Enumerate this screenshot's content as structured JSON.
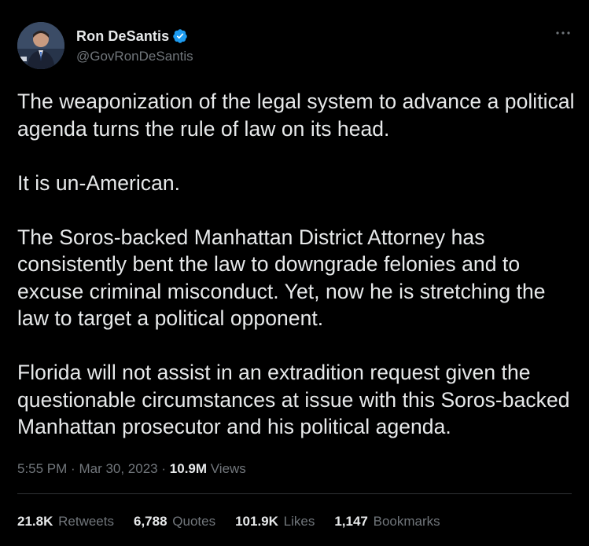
{
  "author": {
    "display_name": "Ron DeSantis",
    "handle": "@GovRonDeSantis",
    "verified_icon": "verified-badge-icon",
    "verified_color": "#1d9bf0"
  },
  "tweet": {
    "paragraphs": [
      "The weaponization of the legal system to advance a political agenda turns the rule of law on its head.",
      "It is un-American.",
      "The Soros-backed Manhattan District Attorney has consistently bent the law to downgrade felonies and to excuse criminal misconduct. Yet, now he is stretching the law to target a political opponent.",
      "Florida will not assist in an extradition request given the questionable circumstances at issue with this Soros-backed Manhattan prosecutor and his political agenda."
    ]
  },
  "meta": {
    "time": "5:55 PM",
    "separator": "·",
    "date": "Mar 30, 2023",
    "views_count": "10.9M",
    "views_label": "Views"
  },
  "stats": {
    "retweets": {
      "count": "21.8K",
      "label": "Retweets"
    },
    "quotes": {
      "count": "6,788",
      "label": "Quotes"
    },
    "likes": {
      "count": "101.9K",
      "label": "Likes"
    },
    "bookmarks": {
      "count": "1,147",
      "label": "Bookmarks"
    }
  },
  "icons": {
    "more": "more-options-icon"
  },
  "colors": {
    "background": "#000000",
    "text_primary": "#e7e9ea",
    "text_secondary": "#71767b",
    "divider": "#2f3336"
  }
}
